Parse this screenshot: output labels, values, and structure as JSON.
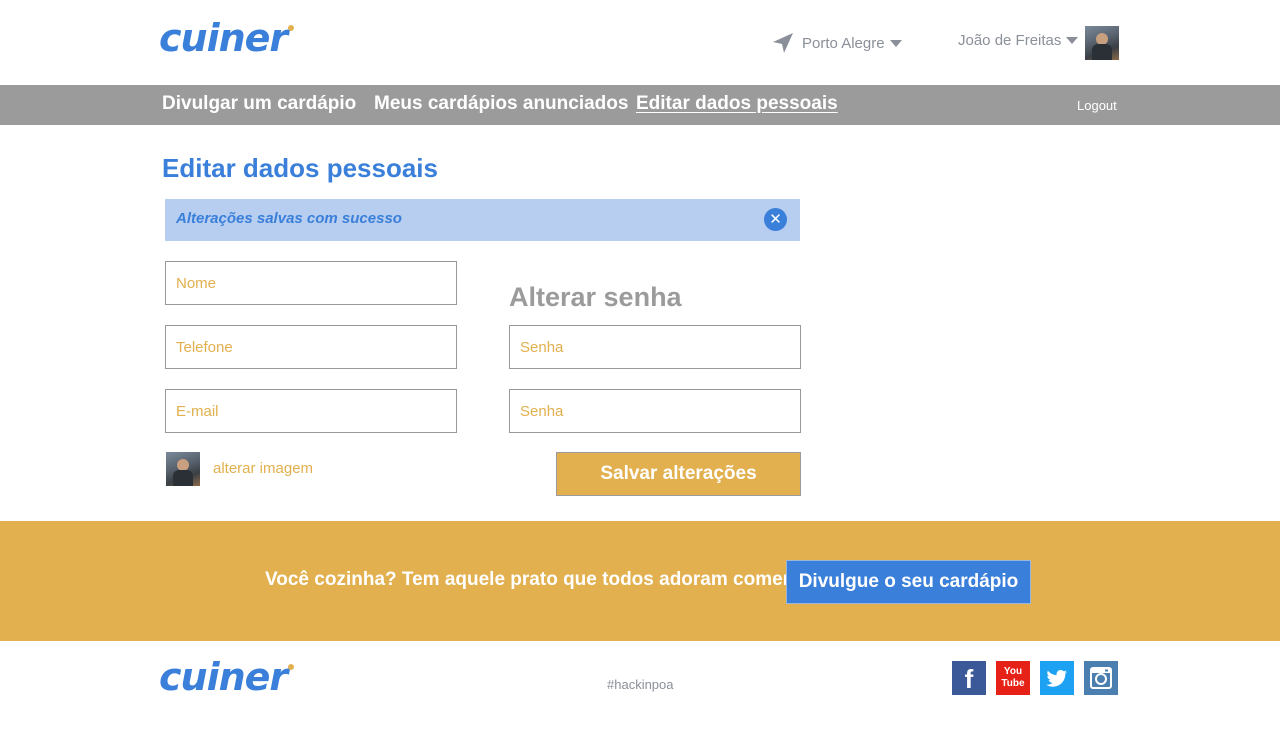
{
  "header": {
    "logo": "cuiner",
    "city": "Porto Alegre",
    "user_name": "João de Freitas"
  },
  "navbar": {
    "links": [
      "Divulgar um cardápio",
      "Meus cardápios anunciados",
      "Editar dados pessoais"
    ],
    "logout": "Logout"
  },
  "main": {
    "title": "Editar dados pessoais",
    "alert": "Alterações salvas com sucesso",
    "fields": {
      "name_placeholder": "Nome",
      "phone_placeholder": "Telefone",
      "email_placeholder": "E-mail",
      "password_placeholder": "Senha",
      "password_confirm_placeholder": "Senha"
    },
    "password_section_title": "Alterar senha",
    "change_image": "alterar imagem",
    "save_button": "Salvar alterações"
  },
  "cta": {
    "text": "Você cozinha? Tem aquele prato que todos adoram comer?",
    "button": "Divulgue o seu cardápio"
  },
  "footer": {
    "logo": "cuiner",
    "hashtag": "#hackinpoa",
    "youtube_line1": "You",
    "youtube_line2": "Tube",
    "facebook_glyph": "f"
  },
  "colors": {
    "brand_blue": "#3a7fd9",
    "brand_yellow": "#e2b04e",
    "nav_gray": "#9b9b9b",
    "alert_bg": "#b7cef0"
  }
}
